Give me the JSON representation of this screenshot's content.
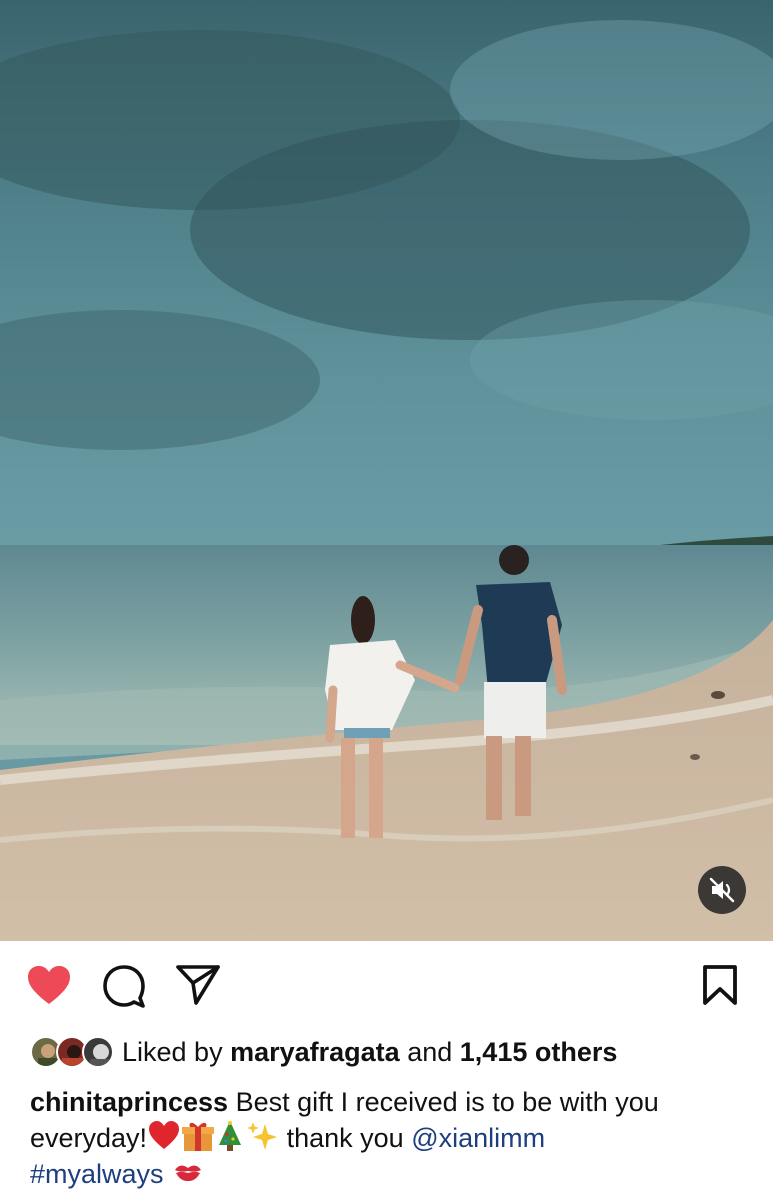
{
  "post": {
    "media": {
      "type": "video",
      "scene_description": "",
      "mute_control": {
        "icon": "speaker-muted-icon",
        "state": "muted"
      }
    },
    "actions": {
      "like": {
        "icon": "heart-filled-icon",
        "active": true,
        "color": "#ed4956"
      },
      "comment": {
        "icon": "comment-bubble-icon"
      },
      "share": {
        "icon": "paper-plane-icon"
      },
      "save": {
        "icon": "bookmark-icon"
      }
    },
    "likes": {
      "prefix": "Liked by",
      "user": "maryafragata",
      "connector": "and",
      "others": "1,415 others",
      "avatar_count": 3
    },
    "caption": {
      "username": "chinitaprincess",
      "text_part1": "Best gift I received is to be with you everyday!",
      "emojis_1": [
        "red-heart-emoji",
        "gift-emoji",
        "christmas-tree-emoji",
        "sparkles-emoji"
      ],
      "text_part2": "thank you",
      "mention": "@xianlimm",
      "hashtag": "#myalways",
      "emoji_end": "kiss-mark-emoji"
    },
    "colors": {
      "link": "#1d3f80",
      "text": "#111111",
      "like_red": "#ed4956"
    }
  }
}
